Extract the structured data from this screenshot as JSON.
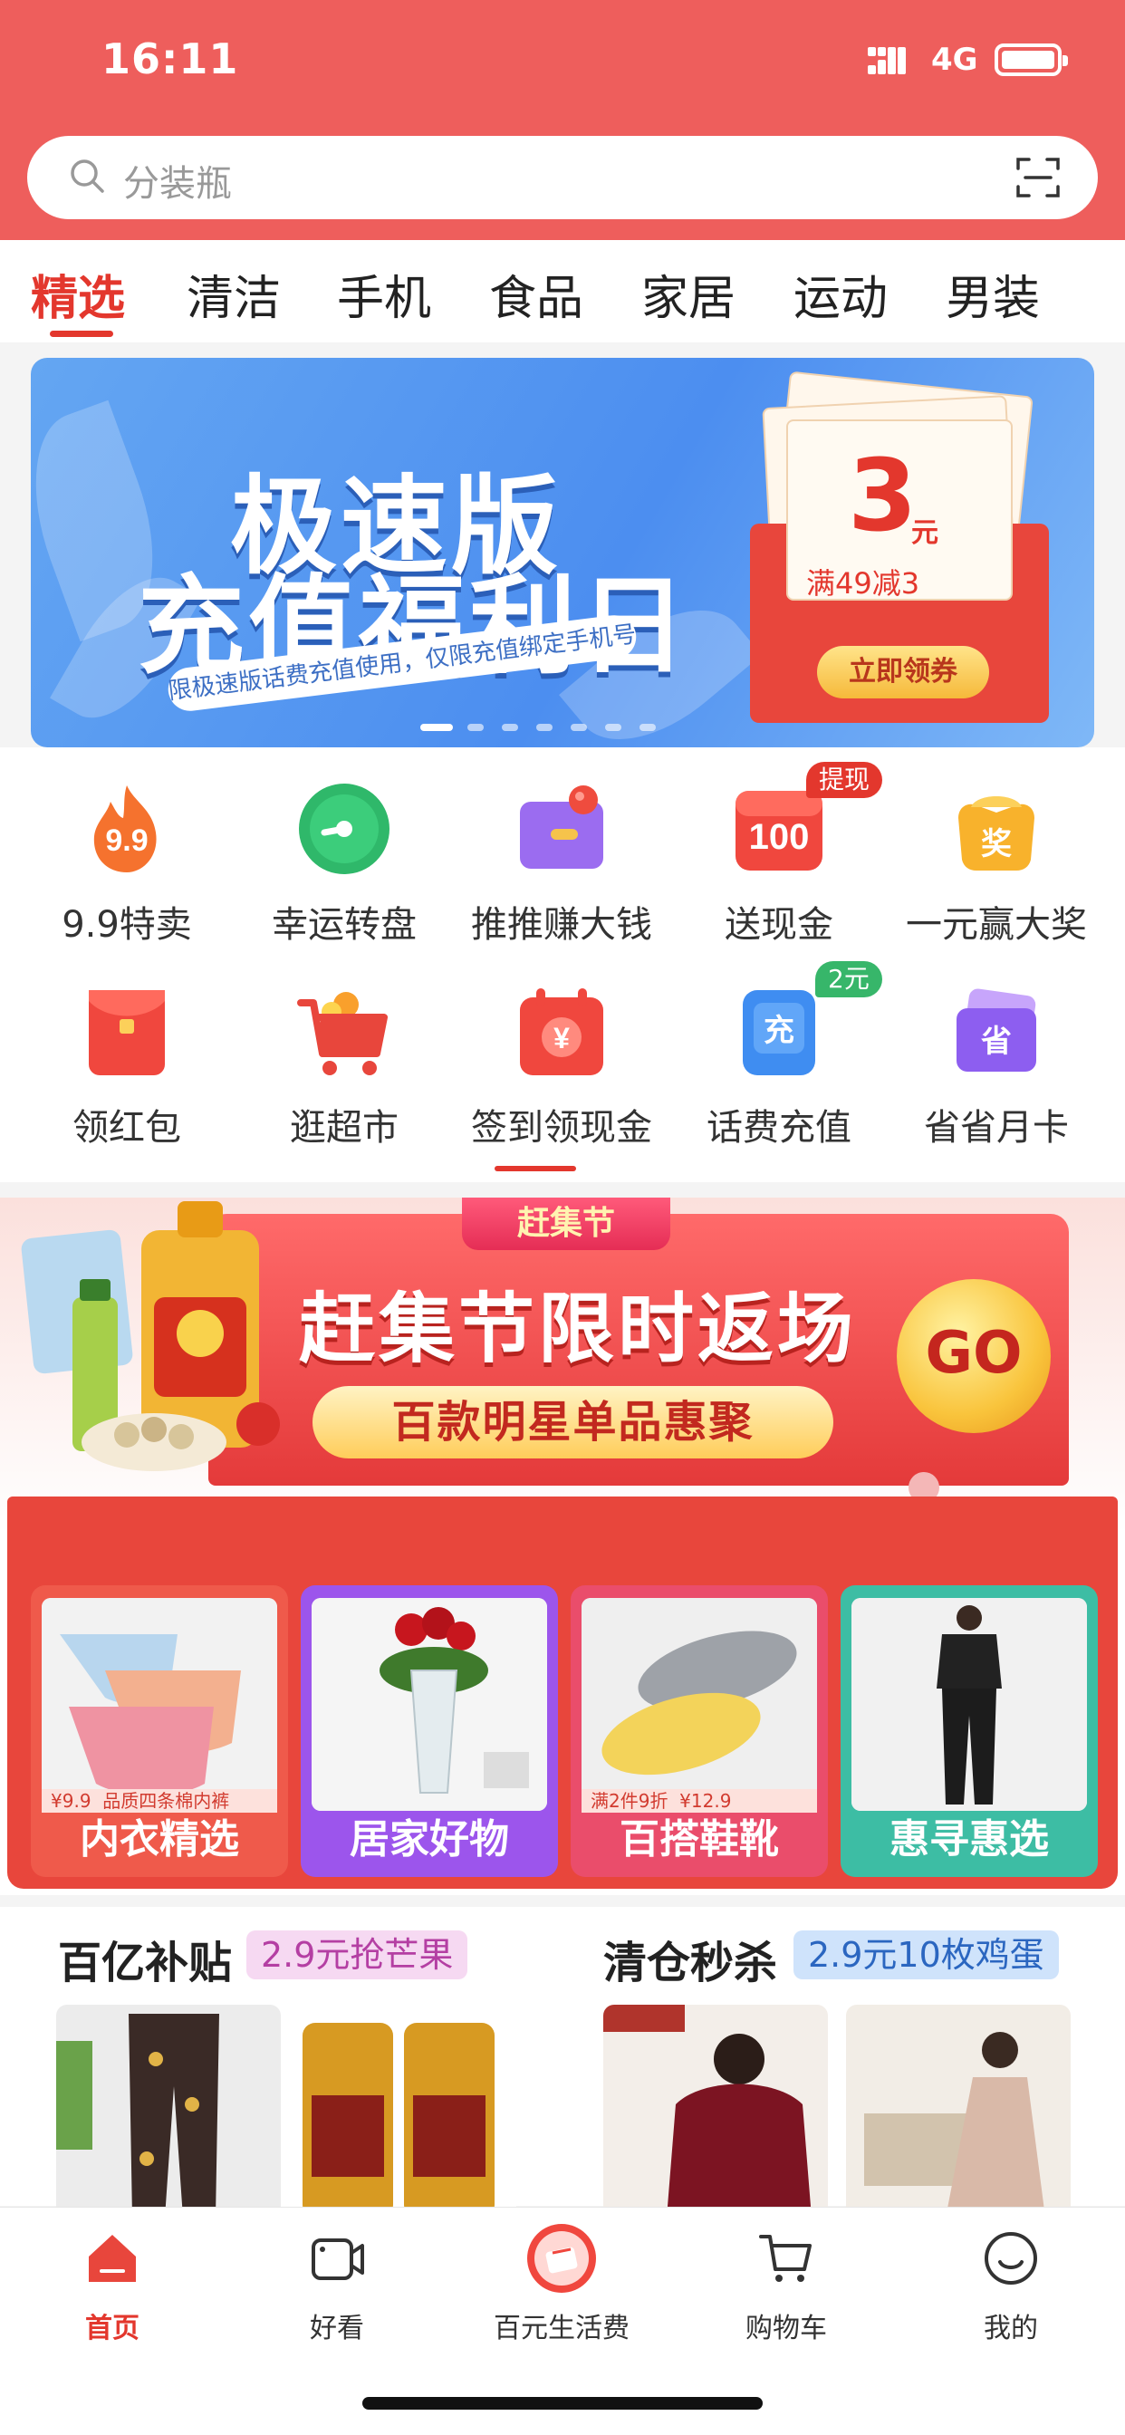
{
  "status": {
    "time": "16:11",
    "network": "4G"
  },
  "search": {
    "placeholder": "分装瓶"
  },
  "tabs": [
    "精选",
    "清洁",
    "手机",
    "食品",
    "家居",
    "运动",
    "男装"
  ],
  "banner": {
    "line1": "极速版",
    "line2": "充值福利日",
    "sub": "限极速版话费充值使用，仅限充值绑定手机号",
    "amount": "3",
    "unit": "元",
    "condition": "满49减3",
    "claim": "立即领券"
  },
  "grid": [
    {
      "label": "9.9特卖",
      "icon": "fire-99-icon",
      "text": "9.9"
    },
    {
      "label": "幸运转盘",
      "icon": "wheel-icon"
    },
    {
      "label": "推推赚大钱",
      "icon": "wallet-icon"
    },
    {
      "label": "送现金",
      "icon": "cash-100-icon",
      "text": "100",
      "badge": "提现"
    },
    {
      "label": "一元赢大奖",
      "icon": "prize-icon",
      "text": "奖"
    },
    {
      "label": "领红包",
      "icon": "red-envelope-icon"
    },
    {
      "label": "逛超市",
      "icon": "cart-icon"
    },
    {
      "label": "签到领现金",
      "icon": "checkin-icon",
      "text": "¥"
    },
    {
      "label": "话费充值",
      "icon": "phone-recharge-icon",
      "text": "充",
      "badge": "2元"
    },
    {
      "label": "省省月卡",
      "icon": "card-icon",
      "text": "省"
    }
  ],
  "promo": {
    "ribbon": "赶集节",
    "title": "赶集节限时返场",
    "subtitle": "百款明星单品惠聚",
    "go": "GO",
    "cards": [
      {
        "name": "内衣精选",
        "price": "9.9",
        "desc": "品质四条棉内裤"
      },
      {
        "name": "居家好物"
      },
      {
        "name": "百搭鞋靴",
        "price": "12.9",
        "desc": "满2件9折"
      },
      {
        "name": "惠寻惠选"
      }
    ]
  },
  "deals": {
    "left_title": "百亿补贴",
    "left_tag": "2.9元抢芒果",
    "right_title": "清仓秒杀",
    "right_tag": "2.9元10枚鸡蛋"
  },
  "tabbar": [
    {
      "label": "首页",
      "icon": "home-icon"
    },
    {
      "label": "好看",
      "icon": "video-icon"
    },
    {
      "label": "百元生活费",
      "icon": "gift-icon"
    },
    {
      "label": "购物车",
      "icon": "cart-icon"
    },
    {
      "label": "我的",
      "icon": "profile-icon"
    }
  ],
  "colors": {
    "brand": "#ee5e5c",
    "accent": "#e3372d"
  }
}
